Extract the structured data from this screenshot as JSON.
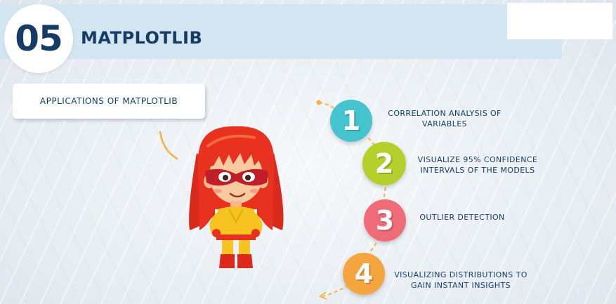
{
  "header": {
    "number": "05",
    "title": "MATPLOTLIB"
  },
  "applications": {
    "label": "APPLICATIONS OF MATPLOTLIB"
  },
  "steps": [
    {
      "number": "1",
      "text": "CORRELATION ANALYSIS OF VARIABLES",
      "color": "#45c3cf"
    },
    {
      "number": "2",
      "text": "VISUALIZE 95% CONFIDENCE INTERVALS OF THE MODELS",
      "color": "#b5cf2c"
    },
    {
      "number": "3",
      "text": "OUTLIER DETECTION",
      "color": "#ef6b78"
    },
    {
      "number": "4",
      "text": "VISUALIZING DISTRIBUTIONS TO GAIN INSTANT INSIGHTS",
      "color": "#f5a53f"
    }
  ],
  "colors": {
    "navy": "#163c66",
    "header_band": "#d3e5f0",
    "connector": "#f2b544",
    "hair": "#e8321f",
    "mask": "#c01f2a",
    "suit": "#f6c320"
  }
}
